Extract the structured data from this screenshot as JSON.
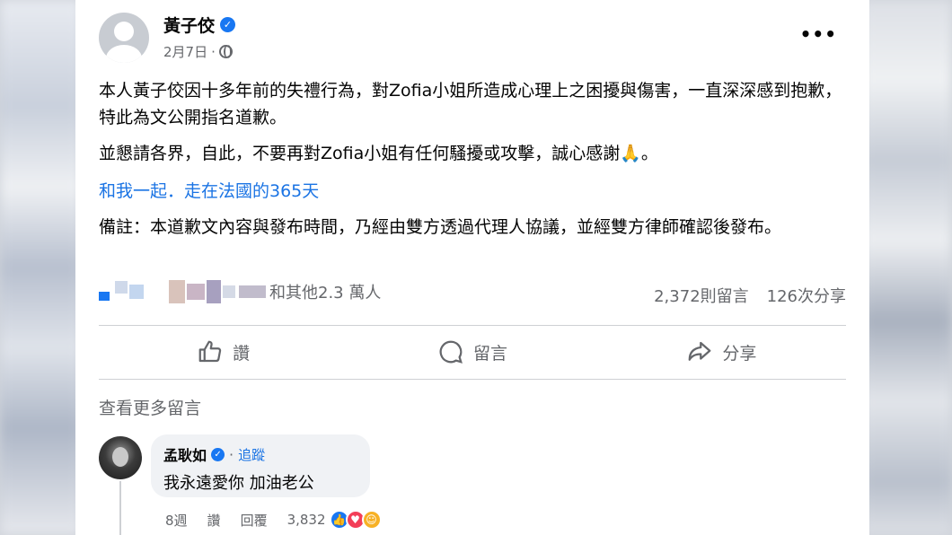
{
  "post": {
    "author": "黃子佼",
    "date": "2月7日",
    "date_separator": "·",
    "more_label": "•••",
    "paragraph1": "本人黃子佼因十多年前的失禮行為，對Zofia小姐所造成心理上之困擾與傷害，一直深深感到抱歉，特此為文公開指名道歉。",
    "paragraph2": "並懇請各界，自此，不要再對Zofia小姐有任何騷擾或攻擊，誠心感謝🙏。",
    "link_text": "和我一起．走在法國的365天",
    "note": "備註：本道歉文內容與發布時間，乃經由雙方透過代理人協議，並經雙方律師確認後發布。"
  },
  "stats": {
    "reactions_text": "和其他2.3 萬人",
    "comments": "2,372則留言",
    "shares": "126次分享"
  },
  "actions": {
    "like": "讚",
    "comment": "留言",
    "share": "分享"
  },
  "comments_section": {
    "view_more": "查看更多留言",
    "comment": {
      "name": "孟耿如",
      "separator": "·",
      "follow": "追蹤",
      "text": "我永遠愛你 加油老公",
      "age": "8週",
      "like": "讚",
      "reply": "回覆",
      "reaction_count": "3,832"
    }
  },
  "colors": {
    "link": "#1b74e4",
    "secondary_text": "#65676b",
    "verified": "#1877f2"
  }
}
